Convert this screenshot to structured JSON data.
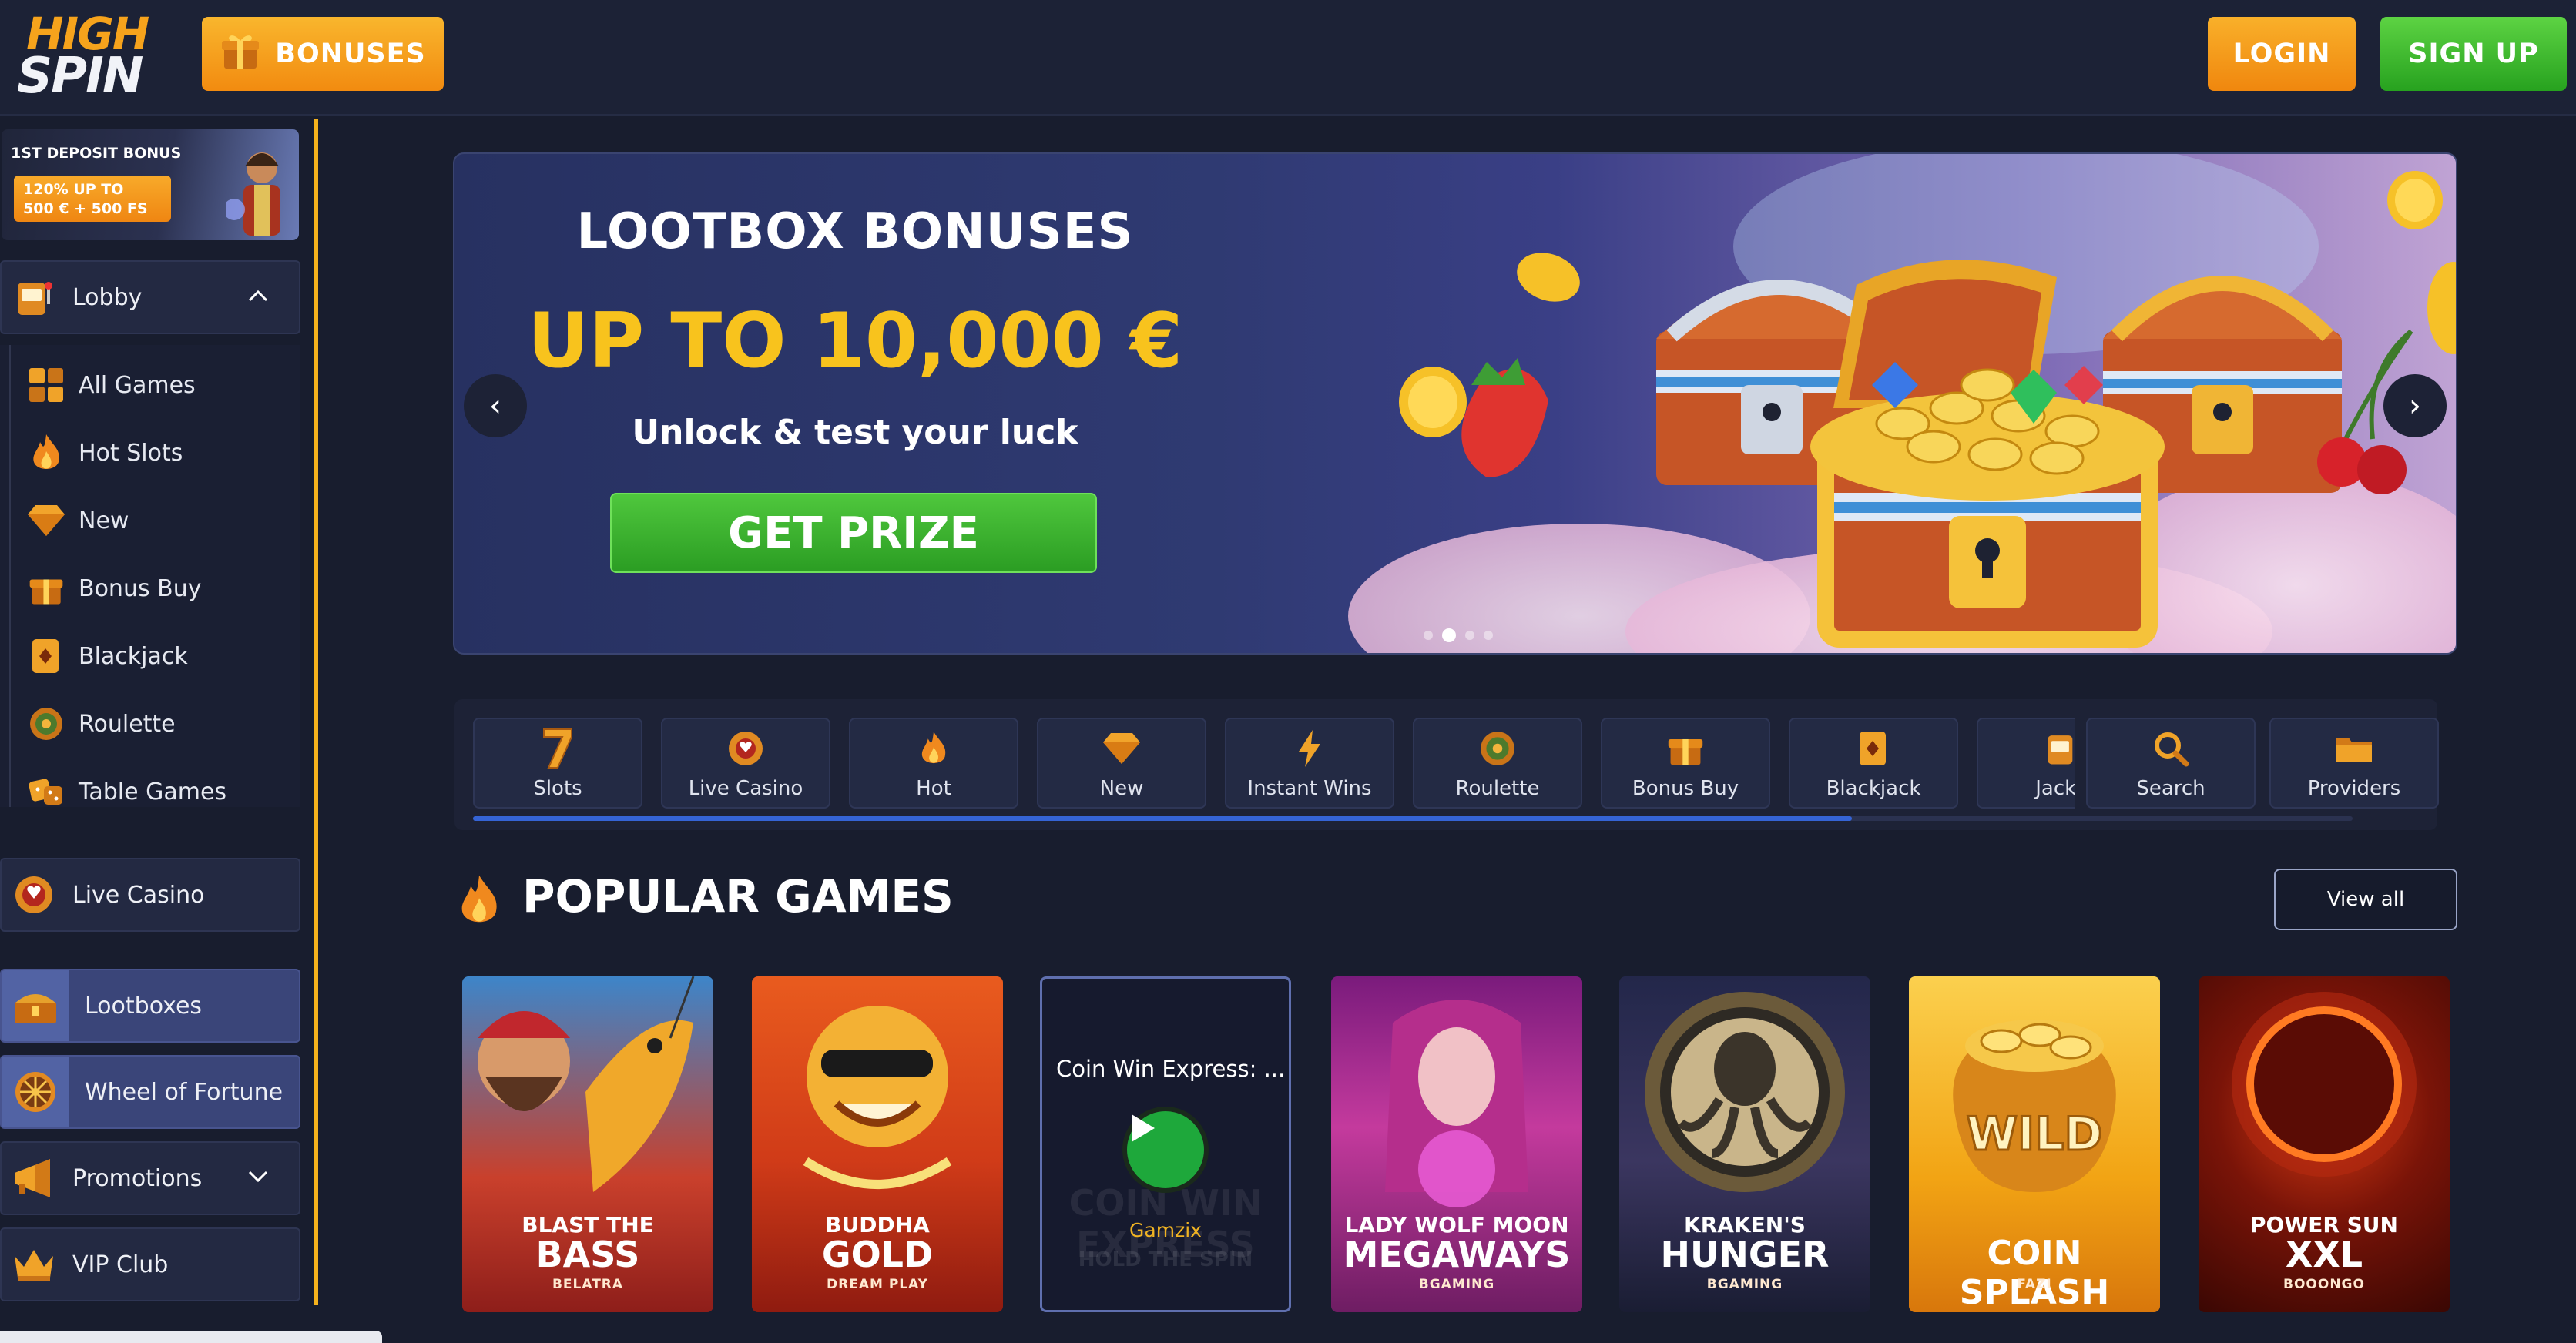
{
  "header": {
    "logo_line1": "HIGH",
    "logo_line2": "SPIN",
    "bonuses_label": "BONUSES",
    "login_label": "LOGIN",
    "signup_label": "SIGN UP"
  },
  "sidebar": {
    "promo": {
      "title": "1ST DEPOSIT BONUS",
      "line1": "120% UP TO",
      "line2": "500 € + 500 FS"
    },
    "lobby_label": "Lobby",
    "lobby_items": [
      {
        "label": "All Games",
        "icon": "grid-icon"
      },
      {
        "label": "Hot Slots",
        "icon": "flame-icon"
      },
      {
        "label": "New",
        "icon": "diamond-icon"
      },
      {
        "label": "Bonus Buy",
        "icon": "gift-icon"
      },
      {
        "label": "Blackjack",
        "icon": "cards-icon"
      },
      {
        "label": "Roulette",
        "icon": "roulette-icon"
      },
      {
        "label": "Table Games",
        "icon": "dice-icon"
      }
    ],
    "live_casino_label": "Live Casino",
    "lootboxes_label": "Lootboxes",
    "wheel_label": "Wheel of Fortune",
    "promotions_label": "Promotions",
    "vip_label": "VIP Club"
  },
  "banner": {
    "title": "LOOTBOX BONUSES",
    "amount": "UP TO 10,000 €",
    "subtitle": "Unlock & test your luck",
    "cta": "GET PRIZE",
    "slide_count": 4,
    "active_slide": 2
  },
  "categories": [
    {
      "label": "Slots",
      "icon": "seven-icon"
    },
    {
      "label": "Live Casino",
      "icon": "chip-icon"
    },
    {
      "label": "Hot",
      "icon": "flame-icon"
    },
    {
      "label": "New",
      "icon": "diamond-icon"
    },
    {
      "label": "Instant Wins",
      "icon": "lightning-icon"
    },
    {
      "label": "Roulette",
      "icon": "roulette-icon"
    },
    {
      "label": "Bonus Buy",
      "icon": "gift-icon"
    },
    {
      "label": "Blackjack",
      "icon": "cards-icon"
    },
    {
      "label": "Jackp",
      "icon": "slot-machine-icon"
    },
    {
      "label": "Search",
      "icon": "search-icon"
    },
    {
      "label": "Providers",
      "icon": "folder-icon"
    }
  ],
  "popular": {
    "title": "POPULAR GAMES",
    "view_all": "View all",
    "games": [
      {
        "sub": "BLAST THE",
        "main": "BASS",
        "provider": "BELATRA"
      },
      {
        "sub": "BUDDHA",
        "main": "GOLD",
        "provider": "DREAM PLAY"
      },
      {
        "hover_title": "Coin Win Express: ...",
        "provider": "Gamzix",
        "ghost1": "COIN WIN EXPRESS",
        "ghost2": "HOLD THE SPIN"
      },
      {
        "sub": "LADY WOLF MOON",
        "main": "MEGAWAYS",
        "provider": "BGAMING"
      },
      {
        "sub": "KRAKEN'S",
        "main": "HUNGER",
        "provider": "BGAMING"
      },
      {
        "sub": "",
        "main": "COIN SPLASH",
        "provider": "FAZI",
        "badge": "WILD"
      },
      {
        "sub": "POWER SUN",
        "main": "XXL",
        "provider": "BOOONGO"
      }
    ]
  },
  "colors": {
    "accent_orange": "#f59a1b",
    "accent_green": "#34b12b",
    "gold": "#f8c31d",
    "bg": "#181d2e"
  }
}
